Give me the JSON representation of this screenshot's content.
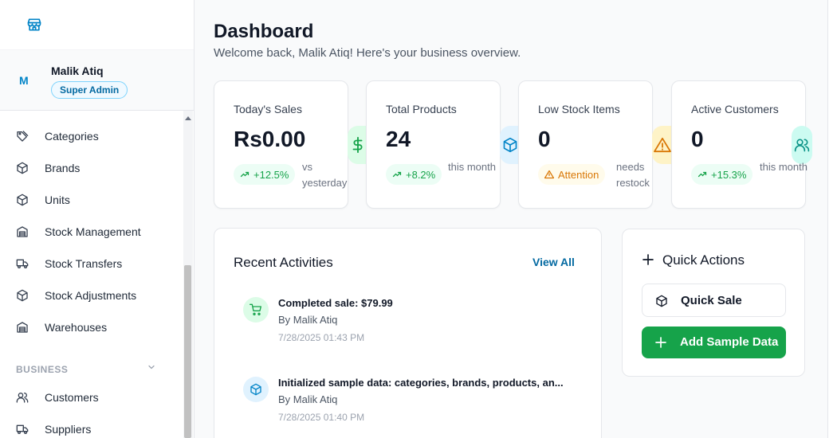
{
  "user": {
    "initial": "M",
    "name": "Malik Atiq",
    "role": "Super Admin"
  },
  "nav": {
    "items": [
      {
        "label": "Categories",
        "icon": "tag-icon"
      },
      {
        "label": "Brands",
        "icon": "box-icon"
      },
      {
        "label": "Units",
        "icon": "box-icon"
      },
      {
        "label": "Stock Management",
        "icon": "warehouse-icon"
      },
      {
        "label": "Stock Transfers",
        "icon": "truck-icon"
      },
      {
        "label": "Stock Adjustments",
        "icon": "box-icon"
      },
      {
        "label": "Warehouses",
        "icon": "warehouse-icon"
      }
    ],
    "section": "BUSINESS",
    "business_items": [
      {
        "label": "Customers",
        "icon": "users-icon"
      },
      {
        "label": "Suppliers",
        "icon": "truck-icon"
      }
    ]
  },
  "page": {
    "title": "Dashboard",
    "subtitle": "Welcome back, Malik Atiq! Here's your business overview."
  },
  "stats": [
    {
      "label": "Today's Sales",
      "value": "Rs0.00",
      "pill": "+12.5%",
      "note": "vs yesterday",
      "icon": "dollar-icon",
      "accent": "#16a34a"
    },
    {
      "label": "Total Products",
      "value": "24",
      "pill": "+8.2%",
      "note": "this month",
      "icon": "package-icon",
      "accent": "#0284c7"
    },
    {
      "label": "Low Stock Items",
      "value": "0",
      "pill": "Attention",
      "note": "needs restock",
      "icon": "warning-icon",
      "accent": "#d97706"
    },
    {
      "label": "Active Customers",
      "value": "0",
      "pill": "+15.3%",
      "note": "this month",
      "icon": "users-icon",
      "accent": "#0d9488"
    }
  ],
  "activities": {
    "title": "Recent Activities",
    "view_all": "View All",
    "items": [
      {
        "text": "Completed sale: $79.99",
        "by": "By Malik Atiq",
        "time": "7/28/2025 01:43 PM",
        "icon": "cart-icon"
      },
      {
        "text": "Initialized sample data: categories, brands, products, an...",
        "by": "By Malik Atiq",
        "time": "7/28/2025 01:40 PM",
        "icon": "package-icon"
      }
    ]
  },
  "quick_actions": {
    "title": "Quick Actions",
    "quick_sale": "Quick Sale",
    "add_sample": "Add Sample Data"
  },
  "colors": {
    "brand": "#0284c7",
    "success": "#16a34a",
    "warning": "#d97706"
  }
}
